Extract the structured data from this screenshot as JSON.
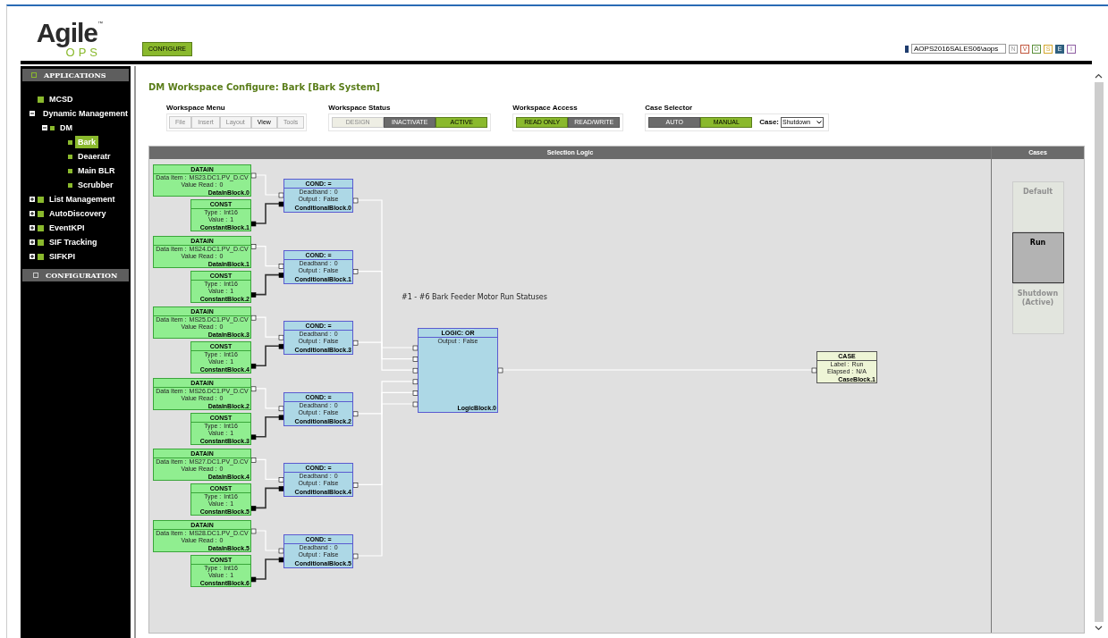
{
  "header": {
    "logo": {
      "word": "Agile",
      "tm": "™",
      "sub": "OPS"
    },
    "configure_button": "CONFIGURE",
    "user": "AOPS2016SALES06\\aops",
    "badges": [
      {
        "label": "N",
        "color": "#9a9a9a",
        "selected": false
      },
      {
        "label": "V",
        "color": "#c0533a",
        "selected": false
      },
      {
        "label": "O",
        "color": "#5a8f3a",
        "selected": false
      },
      {
        "label": "S",
        "color": "#d4a72c",
        "selected": false
      },
      {
        "label": "E",
        "color": "#2e5f7f",
        "selected": true
      },
      {
        "label": "I",
        "color": "#8e5ea2",
        "selected": false
      }
    ]
  },
  "sidebar": {
    "applications": "APPLICATIONS",
    "configuration": "CONFIGURATION",
    "items": [
      {
        "label": "MCSD",
        "selected": false
      },
      {
        "label": "Dynamic Management",
        "selected": false,
        "expanded": true,
        "children": [
          {
            "label": "DM",
            "selected": false,
            "expanded": true,
            "children": [
              {
                "label": "Bark",
                "selected": true
              },
              {
                "label": "Deaeratr",
                "selected": false
              },
              {
                "label": "Main BLR",
                "selected": false
              },
              {
                "label": "Scrubber",
                "selected": false
              }
            ]
          }
        ]
      },
      {
        "label": "List Management",
        "selected": false,
        "expanded": false
      },
      {
        "label": "AutoDiscovery",
        "selected": false,
        "expanded": false
      },
      {
        "label": "EventKPI",
        "selected": false,
        "expanded": false
      },
      {
        "label": "SIF Tracking",
        "selected": false,
        "expanded": false
      },
      {
        "label": "SIFKPI",
        "selected": false,
        "expanded": false
      }
    ]
  },
  "title": "DM Workspace Configure: Bark [Bark System]",
  "workspace_menu": {
    "title": "Workspace Menu",
    "items": [
      {
        "label": "File",
        "selected": false
      },
      {
        "label": "Insert",
        "selected": false
      },
      {
        "label": "Layout",
        "selected": false
      },
      {
        "label": "View",
        "selected": true
      },
      {
        "label": "Tools",
        "selected": false
      }
    ]
  },
  "toggle_groups": [
    {
      "title": "Workspace Status",
      "options": [
        {
          "label": "DESIGN",
          "selected": false,
          "disabled": true
        },
        {
          "label": "INACTIVATE",
          "selected": false,
          "disabled": false
        },
        {
          "label": "ACTIVE",
          "selected": true,
          "disabled": false
        }
      ]
    },
    {
      "title": "Workspace Access",
      "options": [
        {
          "label": "READ ONLY",
          "selected": true,
          "disabled": false
        },
        {
          "label": "READ/WRITE",
          "selected": false,
          "disabled": false
        }
      ]
    },
    {
      "title": "Case Selector",
      "options": [
        {
          "label": "AUTO",
          "selected": false,
          "disabled": false
        },
        {
          "label": "MANUAL",
          "selected": true,
          "disabled": false
        }
      ],
      "case_label": "Case:",
      "case_value": "Shutdown"
    }
  ],
  "diagram": {
    "title": "Selection Logic",
    "note": "#1 - #6 Bark Feeder Motor Run Statuses",
    "groups": [
      {
        "datain": {
          "title": "DATAIN",
          "rows": [
            {
              "label": "Data Item :",
              "value": "MS23.DC1.PV_D.CV"
            },
            {
              "label": "Value Read :",
              "value": "0"
            }
          ],
          "name": "DataInBlock.0"
        },
        "const": {
          "title": "CONST",
          "rows": [
            {
              "label": "Type :",
              "value": "Int16"
            },
            {
              "label": "Value :",
              "value": "1"
            }
          ],
          "name": "ConstantBlock.1"
        },
        "cond": {
          "title": "COND: =",
          "rows": [
            {
              "label": "Deadband :",
              "value": "0"
            },
            {
              "label": "Output :",
              "value": "False"
            }
          ],
          "name": "ConditionalBlock.0"
        }
      },
      {
        "datain": {
          "title": "DATAIN",
          "rows": [
            {
              "label": "Data Item :",
              "value": "MS24.DC1.PV_D.CV"
            },
            {
              "label": "Value Read :",
              "value": "0"
            }
          ],
          "name": "DataInBlock.1"
        },
        "const": {
          "title": "CONST",
          "rows": [
            {
              "label": "Type :",
              "value": "Int16"
            },
            {
              "label": "Value :",
              "value": "1"
            }
          ],
          "name": "ConstantBlock.2"
        },
        "cond": {
          "title": "COND: =",
          "rows": [
            {
              "label": "Deadband :",
              "value": "0"
            },
            {
              "label": "Output :",
              "value": "False"
            }
          ],
          "name": "ConditionalBlock.1"
        }
      },
      {
        "datain": {
          "title": "DATAIN",
          "rows": [
            {
              "label": "Data Item :",
              "value": "MS25.DC1.PV_D.CV"
            },
            {
              "label": "Value Read :",
              "value": "0"
            }
          ],
          "name": "DataInBlock.3"
        },
        "const": {
          "title": "CONST",
          "rows": [
            {
              "label": "Type :",
              "value": "Int16"
            },
            {
              "label": "Value :",
              "value": "1"
            }
          ],
          "name": "ConstantBlock.4"
        },
        "cond": {
          "title": "COND: =",
          "rows": [
            {
              "label": "Deadband :",
              "value": "0"
            },
            {
              "label": "Output :",
              "value": "False"
            }
          ],
          "name": "ConditionalBlock.3"
        }
      },
      {
        "datain": {
          "title": "DATAIN",
          "rows": [
            {
              "label": "Data Item :",
              "value": "MS26.DC1.PV_D.CV"
            },
            {
              "label": "Value Read :",
              "value": "0"
            }
          ],
          "name": "DataInBlock.2"
        },
        "const": {
          "title": "CONST",
          "rows": [
            {
              "label": "Type :",
              "value": "Int16"
            },
            {
              "label": "Value :",
              "value": "1"
            }
          ],
          "name": "ConstantBlock.3"
        },
        "cond": {
          "title": "COND: =",
          "rows": [
            {
              "label": "Deadband :",
              "value": "0"
            },
            {
              "label": "Output :",
              "value": "False"
            }
          ],
          "name": "ConditionalBlock.2"
        }
      },
      {
        "datain": {
          "title": "DATAIN",
          "rows": [
            {
              "label": "Data Item :",
              "value": "MS27.DC1.PV_D.CV"
            },
            {
              "label": "Value Read :",
              "value": "0"
            }
          ],
          "name": "DataInBlock.4"
        },
        "const": {
          "title": "CONST",
          "rows": [
            {
              "label": "Type :",
              "value": "Int16"
            },
            {
              "label": "Value :",
              "value": "1"
            }
          ],
          "name": "ConstantBlock.5"
        },
        "cond": {
          "title": "COND: =",
          "rows": [
            {
              "label": "Deadband :",
              "value": "0"
            },
            {
              "label": "Output :",
              "value": "False"
            }
          ],
          "name": "ConditionalBlock.4"
        }
      },
      {
        "datain": {
          "title": "DATAIN",
          "rows": [
            {
              "label": "Data Item :",
              "value": "MS28.DC1.PV_D.CV"
            },
            {
              "label": "Value Read :",
              "value": "0"
            }
          ],
          "name": "DataInBlock.5"
        },
        "const": {
          "title": "CONST",
          "rows": [
            {
              "label": "Type :",
              "value": "Int16"
            },
            {
              "label": "Value :",
              "value": "1"
            }
          ],
          "name": "ConstantBlock.6"
        },
        "cond": {
          "title": "COND: =",
          "rows": [
            {
              "label": "Deadband :",
              "value": "0"
            },
            {
              "label": "Output :",
              "value": "False"
            }
          ],
          "name": "ConditionalBlock.5"
        }
      }
    ],
    "logic": {
      "title": "LOGIC: OR",
      "rows": [
        {
          "label": "Output :",
          "value": "False"
        }
      ],
      "name": "LogicBlock.0"
    },
    "case": {
      "title": "CASE",
      "rows": [
        {
          "label": "Label :",
          "value": "Run"
        },
        {
          "label": "Elapsed :",
          "value": "N/A"
        }
      ],
      "name": "CaseBlock.1"
    }
  },
  "cases": {
    "title": "Cases",
    "items": [
      {
        "label": "Default",
        "selected": false,
        "disabled": true
      },
      {
        "label": "Run",
        "selected": true,
        "disabled": false
      },
      {
        "label": "Shutdown (Active)",
        "selected": false,
        "disabled": true
      }
    ]
  }
}
